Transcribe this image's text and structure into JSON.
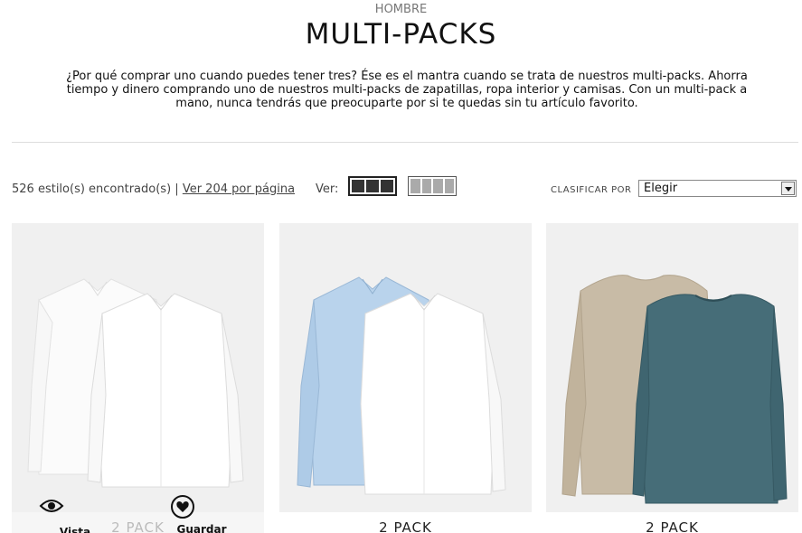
{
  "breadcrumb": "HOMBRE",
  "title": "MULTI-PACKS",
  "description": "¿Por qué comprar uno cuando puedes tener tres? Ése es el mantra cuando se trata de nuestros multi-packs. Ahorra tiempo y dinero comprando uno de nuestros multi-packs de zapatillas, ropa interior y camisas. Con un multi-pack a mano, nunca tendrás que preocuparte por si te quedas sin tu artículo favorito.",
  "toolbar": {
    "count": "526 estilo(s) encontrado(s)",
    "separator": " | ",
    "per_page_link": "Ver 204 por página",
    "view_label": "Ver:",
    "sort_label": "CLASIFICAR POR",
    "sort_value": "Elegir"
  },
  "products": [
    {
      "label": "2 PACK",
      "quick_view": "Vista rápida",
      "save": "Guardar"
    },
    {
      "label": "2 PACK"
    },
    {
      "label": "2 PACK"
    }
  ],
  "colors": {
    "shirt_white": "#ffffff",
    "shirt_blue": "#b9d3ec",
    "tee_beige": "#c8bba6",
    "tee_teal": "#466d78"
  }
}
